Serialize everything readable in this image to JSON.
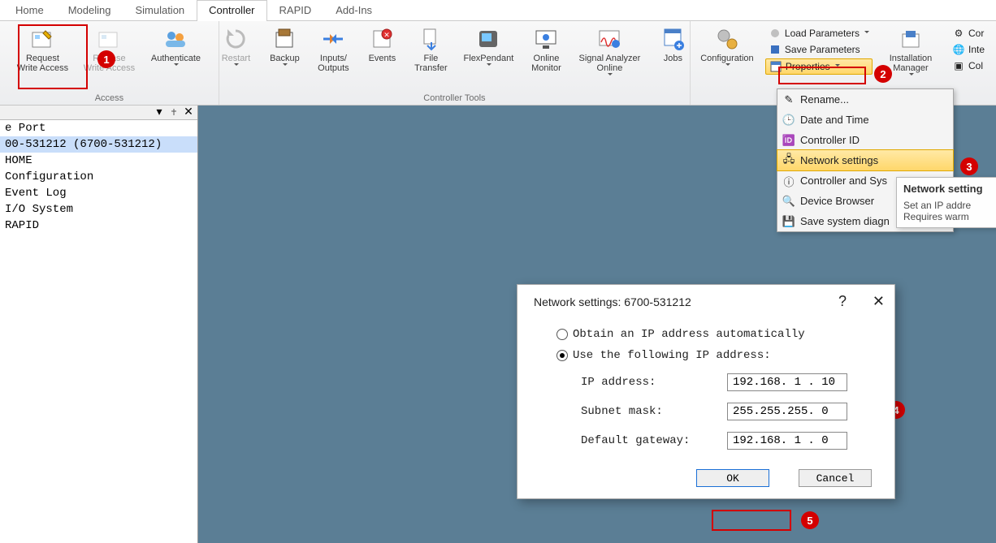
{
  "tabs": [
    "Home",
    "Modeling",
    "Simulation",
    "Controller",
    "RAPID",
    "Add-Ins"
  ],
  "active_tab_index": 3,
  "ribbon": {
    "access": {
      "label": "Access",
      "request": "Request\nWrite Access",
      "release": "Release\nWrite Access",
      "authenticate": "Authenticate"
    },
    "restart": "Restart",
    "backup": "Backup",
    "io": "Inputs/\nOutputs",
    "events": "Events",
    "file_transfer": "File\nTransfer",
    "flexpendant": "FlexPendant",
    "online_monitor": "Online\nMonitor",
    "signal_analyzer": "Signal Analyzer\nOnline",
    "jobs": "Jobs",
    "controller_tools_label": "Controller Tools",
    "configuration": "Configuration",
    "load_params": "Load Parameters",
    "save_params": "Save Parameters",
    "properties": "Properties",
    "installation_mgr": "Installation\nManager",
    "cor": "Cor",
    "inte": "Inte",
    "col": "Col"
  },
  "side": {
    "port": "e Port",
    "node": "00-531212 (6700-531212)",
    "items": [
      "HOME",
      "Configuration",
      "Event Log",
      "I/O System",
      "RAPID"
    ]
  },
  "prop_menu": {
    "rename": "Rename...",
    "date_time": "Date and Time",
    "controller_id": "Controller ID",
    "network": "Network settings",
    "ctrl_sys": "Controller and Sys",
    "device_browser": "Device Browser",
    "save_diag": "Save system diagn"
  },
  "tooltip": {
    "title": "Network setting",
    "line1": "Set an IP addre",
    "line2": "Requires warm"
  },
  "dialog": {
    "title": "Network settings: 6700-531212",
    "opt_auto": "Obtain an IP address automatically",
    "opt_manual": "Use the following IP address:",
    "ip_lbl": "IP address:",
    "ip_val": "192.168. 1 . 10",
    "mask_lbl": "Subnet mask:",
    "mask_val": "255.255.255. 0",
    "gw_lbl": "Default gateway:",
    "gw_val": "192.168. 1 . 0",
    "ok": "OK",
    "cancel": "Cancel"
  },
  "badges": {
    "b1": "1",
    "b2": "2",
    "b3": "3",
    "b4": "4",
    "b5": "5"
  }
}
